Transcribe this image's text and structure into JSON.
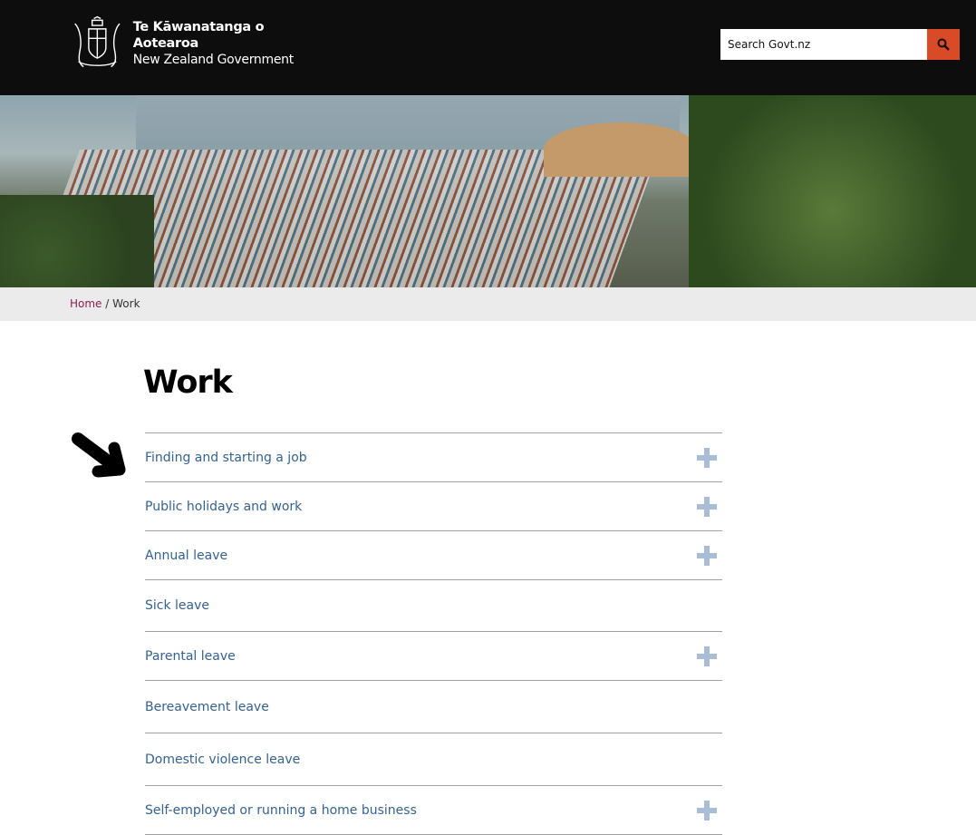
{
  "header": {
    "logo_maori": "Te Kāwanatanga o Aotearoa",
    "logo_english": "New Zealand Government",
    "search_placeholder": "Search Govt.nz",
    "accent": "#d94a26"
  },
  "breadcrumb": {
    "home": "Home",
    "separator": "/",
    "current": "Work"
  },
  "page": {
    "title": "Work"
  },
  "items": [
    {
      "label": "Finding and starting a job",
      "expandable": true
    },
    {
      "label": "Public holidays and work",
      "expandable": true
    },
    {
      "label": "Annual leave",
      "expandable": true
    },
    {
      "label": "Sick leave",
      "expandable": false
    },
    {
      "label": "Parental leave",
      "expandable": true
    },
    {
      "label": "Bereavement leave",
      "expandable": false
    },
    {
      "label": "Domestic violence leave",
      "expandable": false
    },
    {
      "label": "Self-employed or running a home business",
      "expandable": true
    }
  ]
}
